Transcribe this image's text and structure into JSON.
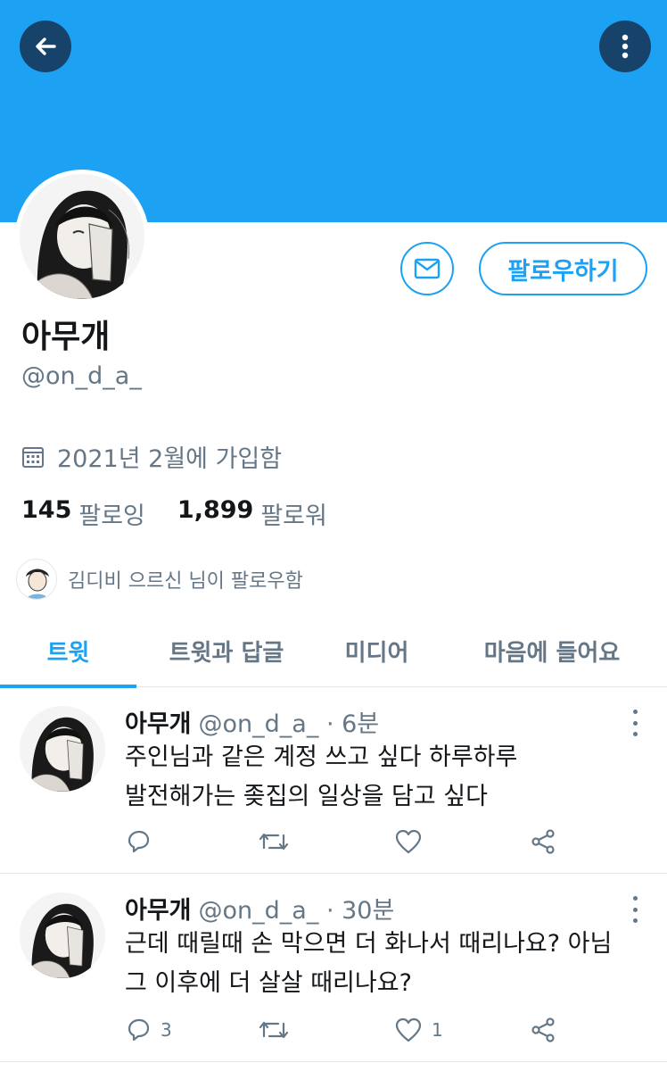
{
  "header": {
    "back_icon": "arrow-left-icon",
    "more_icon": "more-vertical-icon",
    "banner_color": "#1da1f2"
  },
  "profile": {
    "display_name": "아무개",
    "handle": "@on_d_a_",
    "follow_label": "팔로우하기",
    "joined": "2021년 2월에 가입함",
    "following_count": "145",
    "following_label": "팔로잉",
    "followers_count": "1,899",
    "followers_label": "팔로워",
    "followed_by": "김디비 으르신 님이 팔로우함"
  },
  "tabs": [
    {
      "label": "트윗",
      "active": true
    },
    {
      "label": "트윗과 답글",
      "active": false
    },
    {
      "label": "미디어",
      "active": false
    },
    {
      "label": "마음에 들어요",
      "active": false
    }
  ],
  "tweets": [
    {
      "name": "아무개",
      "handle": "@on_d_a_",
      "time": "· 6분",
      "lines": [
        "주인님과 같은 계정 쓰고 싶다 하루하루",
        "발전해가는 좆집의 일상을 담고 싶다"
      ],
      "reply_count": "",
      "retweet_count": "",
      "like_count": ""
    },
    {
      "name": "아무개",
      "handle": "@on_d_a_",
      "time": "· 30분",
      "lines": [
        "근데 때릴때 손 막으면 더 화나서 때리나요? 아님",
        "그 이후에 더 살살 때리나요?"
      ],
      "reply_count": "3",
      "retweet_count": "",
      "like_count": "1"
    }
  ],
  "colors": {
    "accent": "#1da1f2",
    "text": "#14171a",
    "muted": "#657786",
    "dark_button": "#17436a"
  }
}
